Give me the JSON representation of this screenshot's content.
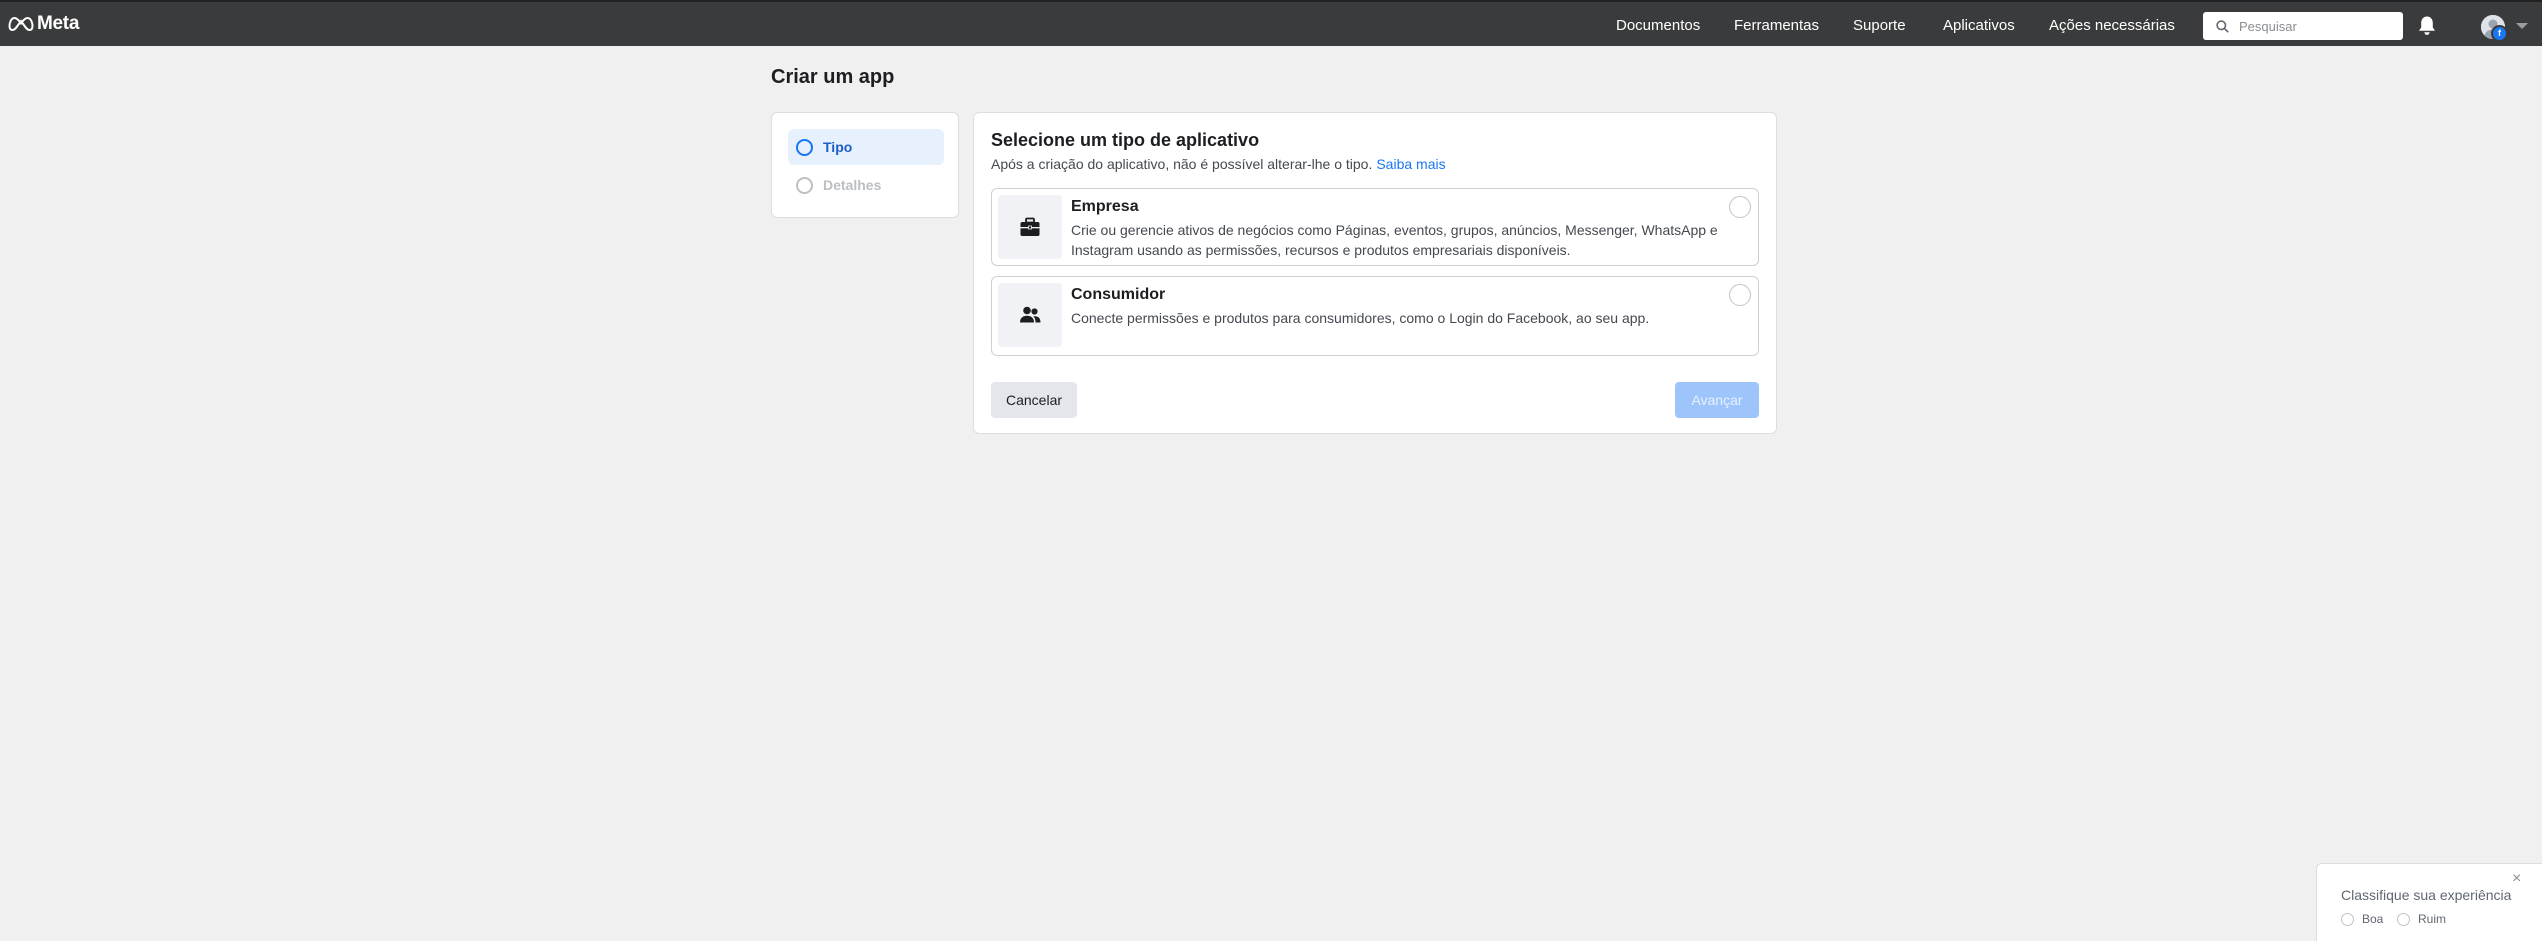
{
  "header": {
    "brand": "Meta",
    "nav": [
      "Documentos",
      "Ferramentas",
      "Suporte",
      "Aplicativos",
      "Ações necessárias"
    ],
    "search_placeholder": "Pesquisar",
    "icons": {
      "search": "search-icon",
      "notifications": "bell-icon",
      "account": "avatar",
      "menu": "chevron-down-icon"
    }
  },
  "page": {
    "title": "Criar um app"
  },
  "stepper": {
    "steps": [
      {
        "label": "Tipo",
        "state": "active"
      },
      {
        "label": "Detalhes",
        "state": "inactive"
      }
    ]
  },
  "main": {
    "title": "Selecione um tipo de aplicativo",
    "subtitle": "Após a criação do aplicativo, não é possível alterar-lhe o tipo.",
    "learn_more": "Saiba mais",
    "options": [
      {
        "title": "Empresa",
        "description": "Crie ou gerencie ativos de negócios como Páginas, eventos, grupos, anúncios, Messenger, WhatsApp e Instagram usando as permissões, recursos e produtos empresariais disponíveis.",
        "icon": "briefcase-icon"
      },
      {
        "title": "Consumidor",
        "description": "Conecte permissões e produtos para consumidores, como o Login do Facebook, ao seu app.",
        "icon": "people-icon"
      }
    ],
    "cancel_label": "Cancelar",
    "next_label": "Avançar"
  },
  "feedback": {
    "close": "×",
    "title": "Classifique sua experiência",
    "options": [
      "Boa",
      "Ruim"
    ]
  },
  "colors": {
    "accent": "#1877f2",
    "topbar": "#3a3b3c",
    "background": "#f0f0f0",
    "disabled_button": "#9ec5fb"
  }
}
